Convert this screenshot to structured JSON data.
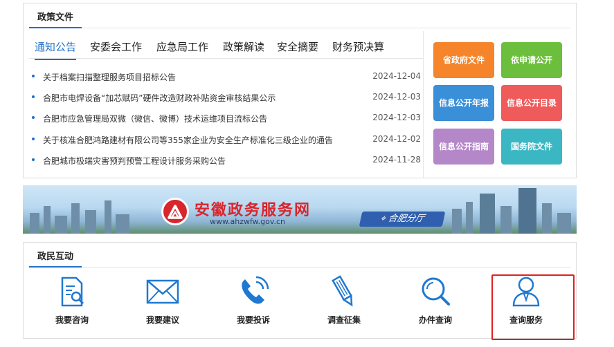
{
  "policy": {
    "title": "政策文件",
    "tabs": [
      "通知公告",
      "安委会工作",
      "应急局工作",
      "政策解读",
      "安全摘要",
      "财务预决算"
    ],
    "news": [
      {
        "title": "关于档案扫描整理服务项目招标公告",
        "date": "2024-12-04"
      },
      {
        "title": "合肥市电焊设备“加芯赋码”硬件改造财政补贴资金审核结果公示",
        "date": "2024-12-03"
      },
      {
        "title": "合肥市应急管理局双微（微信、微博）技术运维项目流标公告",
        "date": "2024-12-03"
      },
      {
        "title": "关于核准合肥鸿路建材有限公司等355家企业为安全生产标准化三级企业的通告",
        "date": "2024-12-02"
      },
      {
        "title": "合肥城市极端灾害预判预警工程设计服务采购公告",
        "date": "2024-11-28"
      }
    ],
    "tiles": [
      {
        "label": "省政府文件",
        "color": "#f5842a"
      },
      {
        "label": "依申请公开",
        "color": "#6cbf3c"
      },
      {
        "label": "信息公开年报",
        "color": "#3a8fd9"
      },
      {
        "label": "信息公开目录",
        "color": "#ef5a5a"
      },
      {
        "label": "信息公开指南",
        "color": "#b487c9"
      },
      {
        "label": "国务院文件",
        "color": "#3bb7c4"
      }
    ]
  },
  "banner": {
    "title": "安徽政务服务网",
    "url": "www.ahzwfw.gov.cn",
    "branch": "合肥分厅",
    "brand_color": "#d8262d"
  },
  "interaction": {
    "title": "政民互动",
    "items": [
      {
        "label": "我要咨询",
        "icon": "document-search-icon"
      },
      {
        "label": "我要建议",
        "icon": "envelope-icon"
      },
      {
        "label": "我要投诉",
        "icon": "phone-icon"
      },
      {
        "label": "调查征集",
        "icon": "pencil-icon"
      },
      {
        "label": "办件查询",
        "icon": "magnifier-icon"
      },
      {
        "label": "查询服务",
        "icon": "person-icon"
      }
    ],
    "icon_color": "#1f78d1",
    "highlight_color": "#e02020"
  }
}
